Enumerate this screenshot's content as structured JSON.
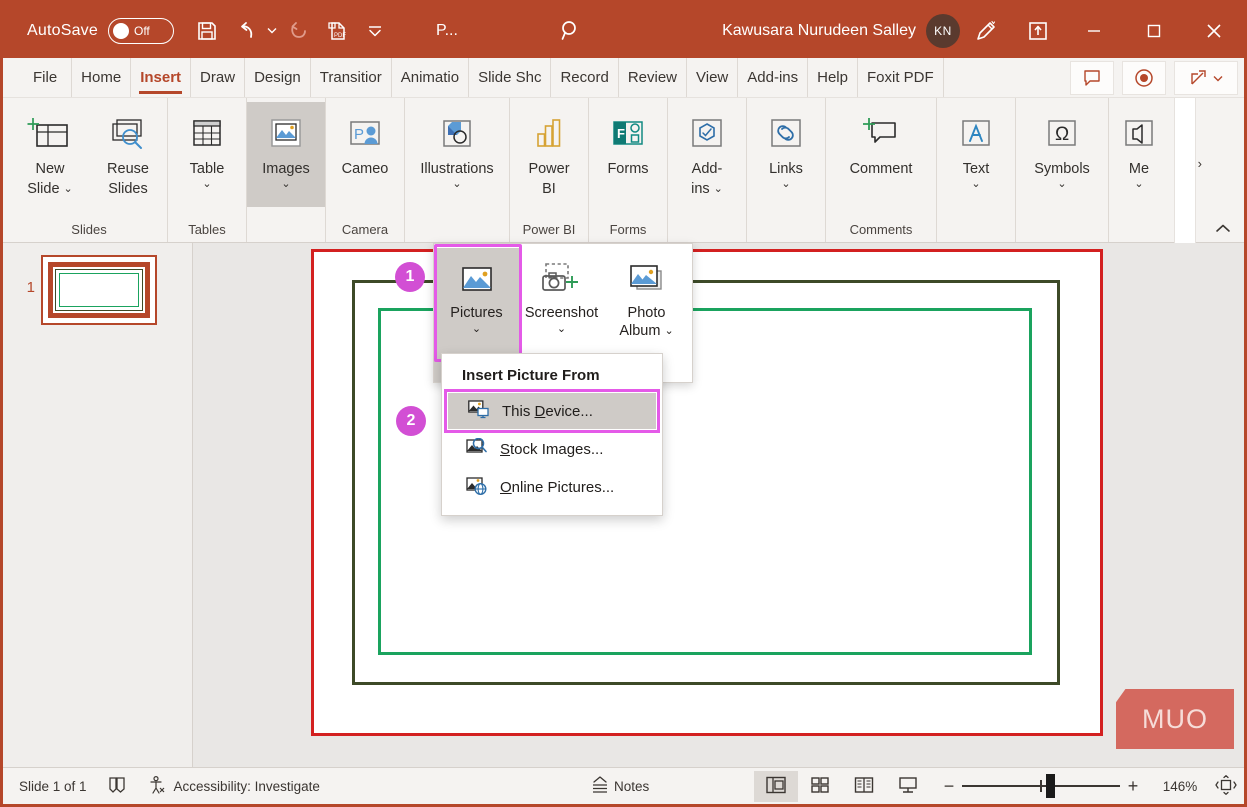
{
  "titlebar": {
    "autosave_label": "AutoSave",
    "autosave_state": "Off",
    "doc_name": "P...",
    "user_name": "Kawusara Nurudeen Salley",
    "avatar_initials": "KN",
    "qat": [
      {
        "name": "save-icon",
        "tip": "Save"
      },
      {
        "name": "undo-icon",
        "tip": "Undo"
      },
      {
        "name": "redo-icon",
        "tip": "Redo"
      },
      {
        "name": "export-pdf-icon",
        "tip": "Export PDF"
      },
      {
        "name": "customize-quick-access-toolbar-icon",
        "tip": "Customize Quick Access Toolbar"
      }
    ],
    "search_icon": "search-icon",
    "pen_icon": "ink-pen-icon",
    "present_icon": "present-icon",
    "minimize": "minimize-icon",
    "maximize": "maximize-icon",
    "close": "close-icon",
    "accent_color": "#b5472a"
  },
  "tabs": [
    {
      "label": "File",
      "active": false
    },
    {
      "label": "Home",
      "active": false
    },
    {
      "label": "Insert",
      "active": true
    },
    {
      "label": "Draw",
      "active": false
    },
    {
      "label": "Design",
      "active": false
    },
    {
      "label": "Transitior",
      "active": false
    },
    {
      "label": "Animatio",
      "active": false
    },
    {
      "label": "Slide Shc",
      "active": false
    },
    {
      "label": "Record",
      "active": false
    },
    {
      "label": "Review",
      "active": false
    },
    {
      "label": "View",
      "active": false
    },
    {
      "label": "Add-ins",
      "active": false
    },
    {
      "label": "Help",
      "active": false
    },
    {
      "label": "Foxit PDF",
      "active": false
    }
  ],
  "tab_right_buttons": [
    {
      "name": "comments-button",
      "icon": "comment-icon"
    },
    {
      "name": "record-button",
      "icon": "record-icon"
    },
    {
      "name": "share-button",
      "icon": "share-icon"
    }
  ],
  "ribbon": {
    "groups": [
      {
        "label": "Slides",
        "items": [
          {
            "label": "New\nSlide",
            "line1": "New",
            "line2": "Slide",
            "icon": "new-slide-icon",
            "has_caret_inline": true,
            "selected": false
          },
          {
            "label": "Reuse\nSlides",
            "line1": "Reuse",
            "line2": "Slides",
            "icon": "reuse-slides-icon",
            "selected": false
          }
        ]
      },
      {
        "label": "Tables",
        "items": [
          {
            "line1": "Table",
            "line2": "",
            "icon": "table-icon",
            "caret": true,
            "selected": false
          }
        ]
      },
      {
        "label": "",
        "items": [
          {
            "line1": "Images",
            "line2": "",
            "icon": "images-icon",
            "caret": true,
            "selected": true
          }
        ]
      },
      {
        "label": "Camera",
        "items": [
          {
            "line1": "Cameo",
            "line2": "",
            "icon": "cameo-icon",
            "selected": false
          }
        ]
      },
      {
        "label": "",
        "items": [
          {
            "line1": "Illustrations",
            "line2": "",
            "icon": "illustrations-icon",
            "caret": true,
            "selected": false
          }
        ]
      },
      {
        "label": "Power BI",
        "items": [
          {
            "line1": "Power",
            "line2": "BI",
            "icon": "power-bi-icon",
            "selected": false
          }
        ]
      },
      {
        "label": "Forms",
        "items": [
          {
            "line1": "Forms",
            "line2": "",
            "icon": "forms-icon",
            "selected": false
          }
        ]
      },
      {
        "label": "",
        "items": [
          {
            "line1": "Add-",
            "line2": "ins",
            "icon": "add-ins-icon",
            "caret_inline": true,
            "selected": false
          }
        ]
      },
      {
        "label": "",
        "items": [
          {
            "line1": "Links",
            "line2": "",
            "icon": "links-icon",
            "caret": true,
            "selected": false
          }
        ]
      },
      {
        "label": "Comments",
        "items": [
          {
            "line1": "Comment",
            "line2": "",
            "icon": "comment-plus-icon",
            "selected": false
          }
        ]
      },
      {
        "label": "",
        "items": [
          {
            "line1": "Text",
            "line2": "",
            "icon": "text-icon",
            "caret": true,
            "selected": false
          }
        ]
      },
      {
        "label": "",
        "items": [
          {
            "line1": "Symbols",
            "line2": "",
            "icon": "omega-symbols-icon",
            "caret": true,
            "selected": false
          }
        ]
      },
      {
        "label": "",
        "items": [
          {
            "line1": "Me",
            "line2": "",
            "icon": "media-icon",
            "caret": true,
            "selected": false
          }
        ]
      }
    ],
    "scroll_right_glyph": "›",
    "collapse_glyph": "⌃"
  },
  "gallery": {
    "items": [
      {
        "label": "Pictures",
        "icon": "pictures-icon",
        "caret": true,
        "selected": true
      },
      {
        "label": "Screenshot",
        "icon": "screenshot-icon",
        "caret": true,
        "selected": false
      },
      {
        "label": "Photo",
        "label2": "Album",
        "icon": "photo-album-icon",
        "caret_inline": true,
        "selected": false
      }
    ]
  },
  "insert_picture_menu": {
    "title": "Insert Picture From",
    "items": [
      {
        "prefix": "This ",
        "key": "D",
        "suffix": "evice...",
        "icon": "this-device-icon",
        "selected": true
      },
      {
        "prefix": "",
        "key": "S",
        "suffix": "tock Images...",
        "icon": "stock-images-icon",
        "selected": false
      },
      {
        "prefix": "",
        "key": "O",
        "suffix": "nline Pictures...",
        "icon": "online-pictures-icon",
        "selected": false
      }
    ]
  },
  "badges": [
    {
      "number": "1"
    },
    {
      "number": "2"
    }
  ],
  "thumbnails": [
    {
      "number": "1",
      "selected": true
    }
  ],
  "slide": {
    "border_outer_color": "#d32020",
    "border_middle_color": "#3d4a28",
    "border_inner_color": "#1aa35e"
  },
  "statusbar": {
    "slide_count": "Slide 1 of 1",
    "spellcheck_icon": "spellcheck-icon",
    "accessibility_icon": "accessibility-icon",
    "accessibility_label": "Accessibility: Investigate",
    "notes_label": "Notes",
    "notes_icon": "notes-icon",
    "views": [
      {
        "name": "normal-view-button",
        "icon": "normal-view-icon",
        "active": true
      },
      {
        "name": "slide-sorter-view-button",
        "icon": "slide-sorter-icon",
        "active": false
      },
      {
        "name": "reading-view-button",
        "icon": "reading-view-icon",
        "active": false
      },
      {
        "name": "slide-show-button",
        "icon": "slide-show-icon",
        "active": false
      }
    ],
    "zoom_out": "−",
    "zoom_in": "+",
    "zoom_percent": "146%",
    "fit_icon": "fit-slide-icon"
  },
  "watermark": {
    "text": "MUO",
    "color": "#d4695f"
  }
}
